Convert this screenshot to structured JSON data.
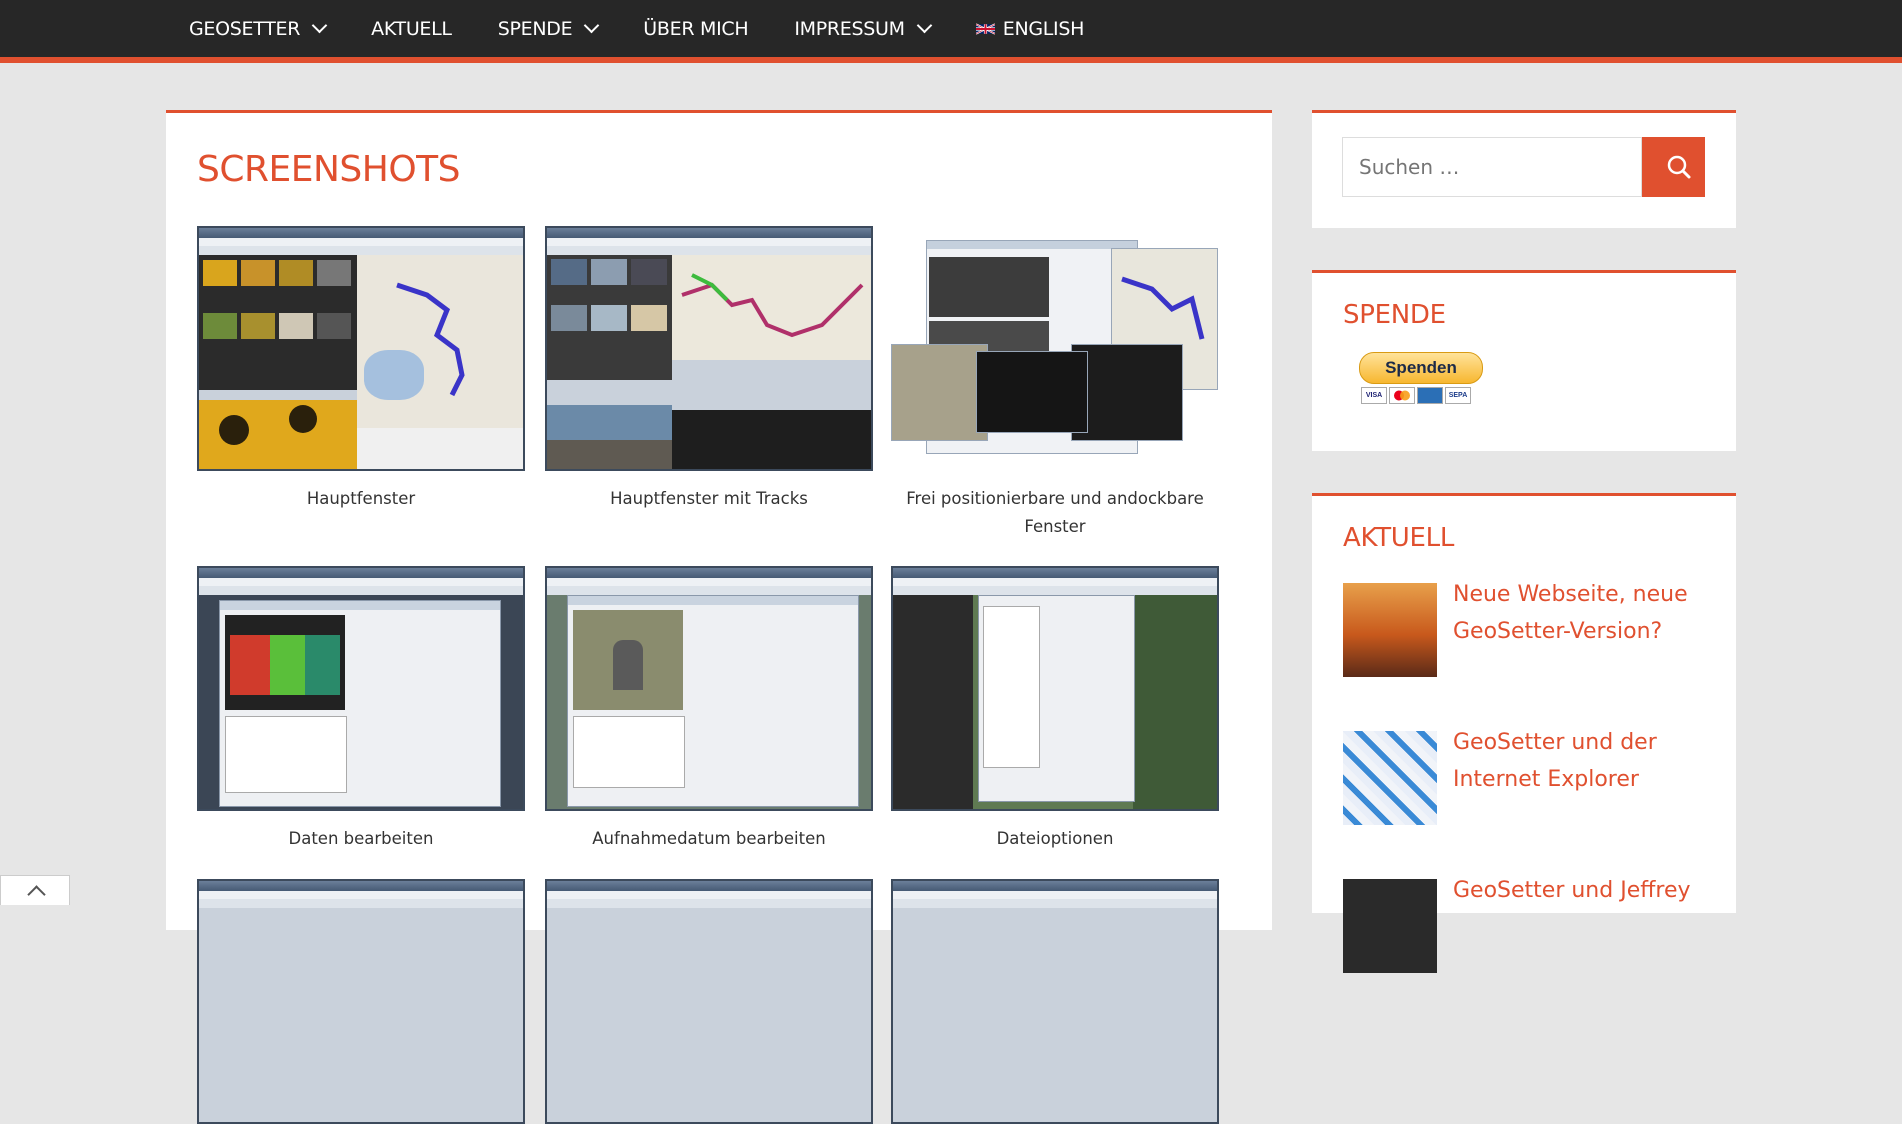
{
  "nav": {
    "items": [
      {
        "label": "GEOSETTER",
        "has_dropdown": true
      },
      {
        "label": "AKTUELL",
        "has_dropdown": false
      },
      {
        "label": "SPENDE",
        "has_dropdown": true
      },
      {
        "label": "ÜBER MICH",
        "has_dropdown": false
      },
      {
        "label": "IMPRESSUM",
        "has_dropdown": true
      }
    ],
    "language": "ENGLISH",
    "language_flag": "uk-flag-icon"
  },
  "main": {
    "title": "SCREENSHOTS",
    "gallery": [
      {
        "caption": "Hauptfenster"
      },
      {
        "caption": "Hauptfenster mit Tracks"
      },
      {
        "caption": "Frei positionierbare und andockbare Fenster"
      },
      {
        "caption": "Daten bearbeiten"
      },
      {
        "caption": "Aufnahmedatum bearbeiten"
      },
      {
        "caption": "Dateioptionen"
      }
    ]
  },
  "sidebar": {
    "search": {
      "placeholder": "Suchen …",
      "button_icon": "search-icon"
    },
    "donate": {
      "title": "SPENDE",
      "button_label": "Spenden",
      "cards": [
        "VISA",
        "MC",
        "",
        "SEPA"
      ]
    },
    "news": {
      "title": "AKTUELL",
      "posts": [
        {
          "title": "Neue Webseite, neue GeoSetter-Version?"
        },
        {
          "title": "GeoSetter und der Internet Explorer"
        },
        {
          "title": "GeoSetter und Jeffrey"
        }
      ]
    }
  },
  "colors": {
    "accent": "#e0502f",
    "nav_bg": "#272727",
    "page_bg": "#e6e6e6"
  },
  "scroll_top_icon": "chevron-up-icon"
}
